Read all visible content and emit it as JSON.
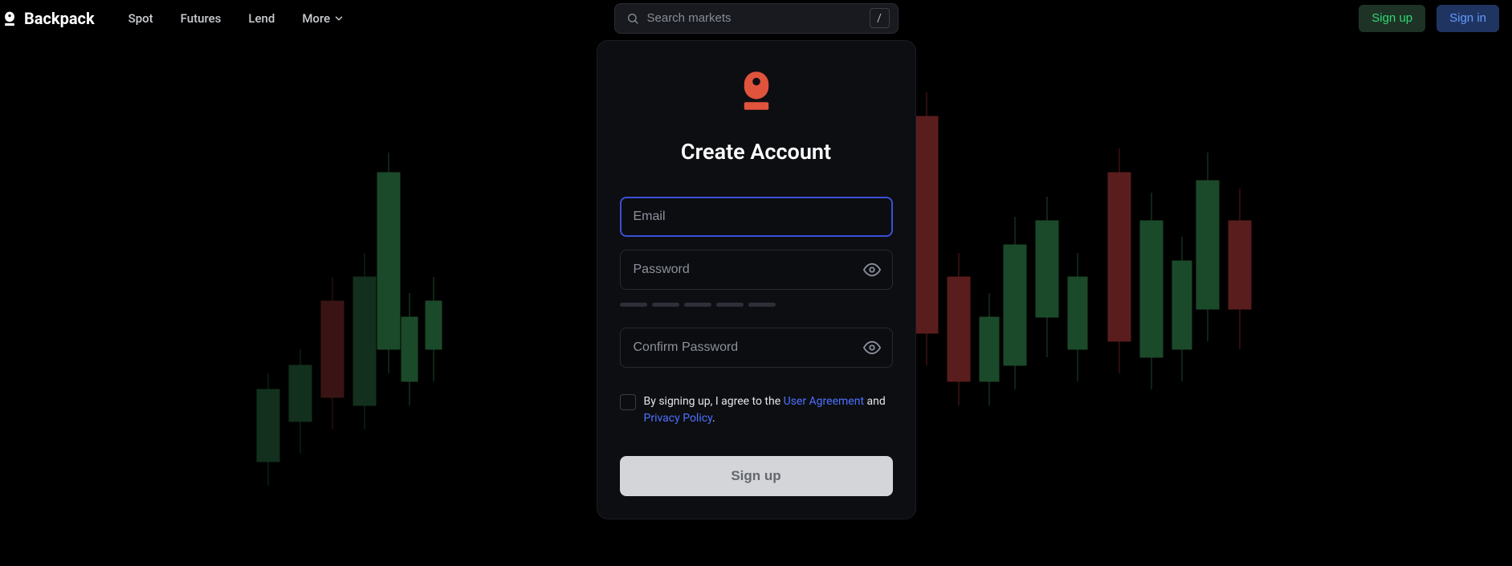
{
  "brand": "Backpack",
  "nav": {
    "spot": "Spot",
    "futures": "Futures",
    "lend": "Lend",
    "more": "More"
  },
  "search": {
    "placeholder": "Search markets",
    "shortcut": "/"
  },
  "auth": {
    "signup": "Sign up",
    "signin": "Sign in"
  },
  "card": {
    "title": "Create Account",
    "email_placeholder": "Email",
    "password_placeholder": "Password",
    "confirm_placeholder": "Confirm Password",
    "terms_prefix": "By signing up, I agree to the ",
    "terms_link1": "User Agreement",
    "terms_mid": " and ",
    "terms_link2": "Privacy Policy",
    "terms_suffix": ".",
    "submit": "Sign up"
  },
  "colors": {
    "accent_green": "#2fd971",
    "accent_blue": "#639bff",
    "focus_border": "#3b4fd6",
    "brand_red": "#e0533d"
  }
}
